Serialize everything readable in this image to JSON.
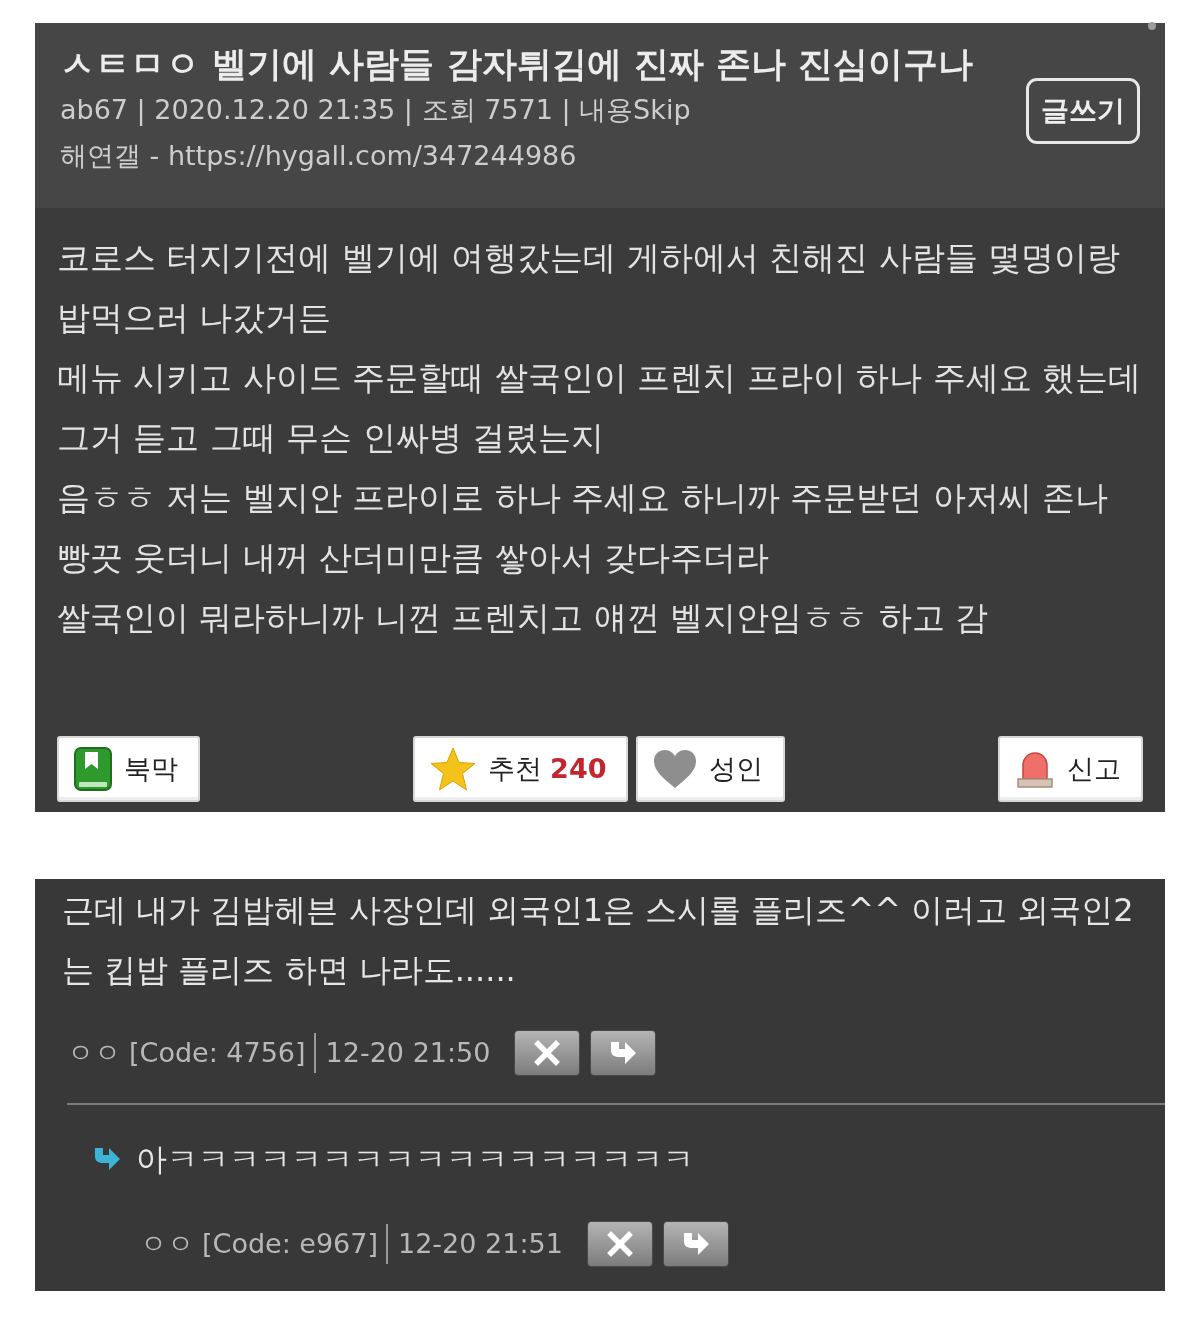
{
  "post": {
    "title": "ㅅㅌㅁㅇ 벨기에 사람들 감자튀김에 진짜 존나 진심이구나",
    "meta": "ab67 | 2020.12.20  21:35 | 조회 7571 | 내용Skip",
    "source": "해연갤 - https://hygall.com/347244986",
    "write_button": "글쓰기",
    "body": [
      "코로스 터지기전에 벨기에 여행갔는데 게하에서 친해진 사람들 몇명이랑 밥먹으러 나갔거든",
      "메뉴 시키고 사이드 주문할때 쌀국인이 프렌치 프라이 하나 주세요 했는데 그거 듣고 그때 무슨 인싸병 걸렸는지",
      "음ㅎㅎ 저는 벨지안 프라이로 하나 주세요 하니까 주문받던 아저씨 존나 빵끗 웃더니 내꺼 산더미만큼 쌓아서 갖다주더라",
      "쌀국인이 뭐라하니까 니껀 프렌치고 얘껀 벨지안임ㅎㅎ 하고 감"
    ],
    "actions": [
      {
        "kind": "bookmark",
        "label": "북막"
      },
      {
        "kind": "recommend",
        "label": "추천",
        "count": "240"
      },
      {
        "kind": "adult",
        "label": "성인"
      },
      {
        "kind": "report",
        "label": "신고"
      }
    ]
  },
  "comments": [
    {
      "text": "근데 내가 김밥헤븐 사장인데 외국인1은 스시롤 플리즈^^ 이러고 외국인2는 킵밥 플리즈 하면 나라도......",
      "author": "ㅇㅇ",
      "code": "[Code: 4756]",
      "time": "12-20 21:50",
      "children": [
        {
          "text": "아ㅋㅋㅋㅋㅋㅋㅋㅋㅋㅋㅋㅋㅋㅋㅋㅋㅋ",
          "author": "ㅇㅇ",
          "code": "[Code: e967]",
          "time": "12-20 21:51"
        }
      ]
    }
  ]
}
